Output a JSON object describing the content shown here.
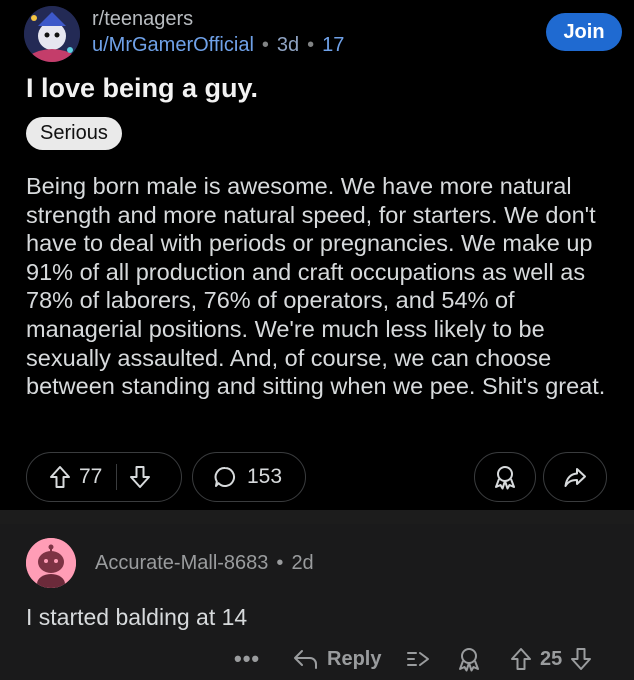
{
  "post": {
    "subreddit": "r/teenagers",
    "author": "u/MrGamerOfficial",
    "age": "3d",
    "extra": "17",
    "join_label": "Join",
    "title": "I love being a guy.",
    "flair": "Serious",
    "body": "Being born male is awesome. We have more natural strength and more natural speed, for starters. We don't have to deal with periods or pregnancies. We make up 91% of all production and craft occupations as well as 78% of laborers, 76% of operators, and 54% of managerial positions. We're much less likely to be sexually assaulted. And, of course, we can choose between standing and sitting when we pee. Shit's great.",
    "upvotes": "77",
    "comments": "153"
  },
  "comment": {
    "author": "Accurate-Mall-8683",
    "age": "2d",
    "body": "I started balding at 14",
    "more": "•••",
    "reply_label": "Reply",
    "upvotes": "25"
  },
  "colors": {
    "background": "#000000",
    "join_button": "#1f6ad1",
    "username": "#6fa1e8",
    "comment_background": "#1a1a1b"
  },
  "icons": {
    "upvote": "arrow-up-icon",
    "downvote": "arrow-down-icon",
    "comment": "speech-bubble-icon",
    "award": "award-icon",
    "share": "share-icon",
    "reply": "reply-arrow-icon",
    "collapse": "collapse-arrow-icon"
  }
}
